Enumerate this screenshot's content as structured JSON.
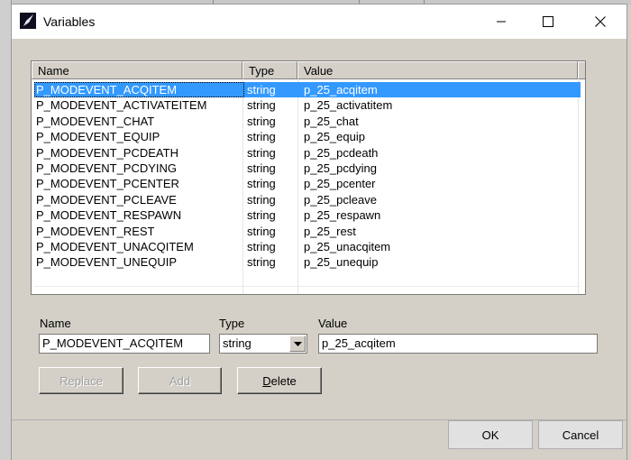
{
  "window": {
    "title": "Variables"
  },
  "list": {
    "headers": {
      "name": "Name",
      "type": "Type",
      "value": "Value"
    },
    "rows": [
      {
        "name": "P_MODEVENT_ACQITEM",
        "type": "string",
        "value": "p_25_acqitem"
      },
      {
        "name": "P_MODEVENT_ACTIVATEITEM",
        "type": "string",
        "value": "p_25_activatitem"
      },
      {
        "name": "P_MODEVENT_CHAT",
        "type": "string",
        "value": "p_25_chat"
      },
      {
        "name": "P_MODEVENT_EQUIP",
        "type": "string",
        "value": "p_25_equip"
      },
      {
        "name": "P_MODEVENT_PCDEATH",
        "type": "string",
        "value": "p_25_pcdeath"
      },
      {
        "name": "P_MODEVENT_PCDYING",
        "type": "string",
        "value": "p_25_pcdying"
      },
      {
        "name": "P_MODEVENT_PCENTER",
        "type": "string",
        "value": "p_25_pcenter"
      },
      {
        "name": "P_MODEVENT_PCLEAVE",
        "type": "string",
        "value": "p_25_pcleave"
      },
      {
        "name": "P_MODEVENT_RESPAWN",
        "type": "string",
        "value": "p_25_respawn"
      },
      {
        "name": "P_MODEVENT_REST",
        "type": "string",
        "value": "p_25_rest"
      },
      {
        "name": "P_MODEVENT_UNACQITEM",
        "type": "string",
        "value": "p_25_unacqitem"
      },
      {
        "name": "P_MODEVENT_UNEQUIP",
        "type": "string",
        "value": "p_25_unequip"
      }
    ],
    "selected_index": 0
  },
  "editor": {
    "name_label": "Name",
    "type_label": "Type",
    "value_label": "Value",
    "name_value": "P_MODEVENT_ACQITEM",
    "type_value": "string",
    "value_value": "p_25_acqitem"
  },
  "actions": {
    "replace_label": "Replace",
    "add_label": "Add",
    "delete_first": "D",
    "delete_rest": "elete"
  },
  "footer": {
    "ok_label": "OK",
    "cancel_label": "Cancel"
  },
  "icons": {
    "app": "app-window-icon",
    "minimize": "minimize-icon",
    "maximize": "maximize-icon",
    "close": "close-icon",
    "dropdown": "chevron-down-icon"
  }
}
